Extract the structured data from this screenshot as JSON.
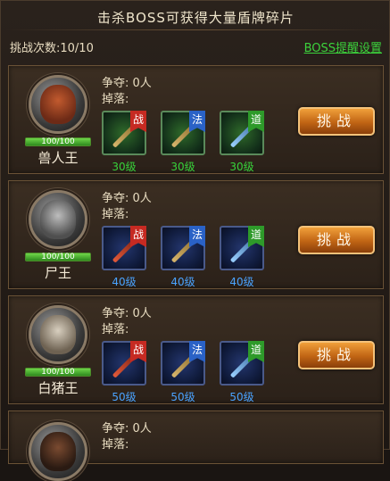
{
  "header": {
    "title": "击杀BOSS可获得大量盾牌碎片",
    "challenge_label": "挑战次数:10/10",
    "remind_link": "BOSS提醒设置"
  },
  "bosses": [
    {
      "name": "兽人王",
      "portrait_icon": "orc-king-portrait",
      "hp_text": "100/100",
      "contest": "争夺: 0人",
      "drop_label": "掉落:",
      "drops": [
        {
          "tag": "战",
          "level": "30级",
          "rarity": "green"
        },
        {
          "tag": "法",
          "level": "30级",
          "rarity": "green"
        },
        {
          "tag": "道",
          "level": "30级",
          "rarity": "green"
        }
      ],
      "button": "挑战"
    },
    {
      "name": "尸王",
      "portrait_icon": "corpse-king-portrait",
      "hp_text": "100/100",
      "contest": "争夺: 0人",
      "drop_label": "掉落:",
      "drops": [
        {
          "tag": "战",
          "level": "40级",
          "rarity": "blue"
        },
        {
          "tag": "法",
          "level": "40级",
          "rarity": "blue"
        },
        {
          "tag": "道",
          "level": "40级",
          "rarity": "blue"
        }
      ],
      "button": "挑战"
    },
    {
      "name": "白猪王",
      "portrait_icon": "white-boar-king-portrait",
      "hp_text": "100/100",
      "contest": "争夺: 0人",
      "drop_label": "掉落:",
      "drops": [
        {
          "tag": "战",
          "level": "50级",
          "rarity": "blue"
        },
        {
          "tag": "法",
          "level": "50级",
          "rarity": "blue"
        },
        {
          "tag": "道",
          "level": "50级",
          "rarity": "blue"
        }
      ],
      "button": "挑战"
    },
    {
      "name": "",
      "portrait_icon": "boss-portrait",
      "contest": "争夺: 0人",
      "drop_label": "掉落:"
    }
  ],
  "colors": {
    "green_level": "#37d23a",
    "blue_level": "#4aa3ff",
    "link": "#3cd23c"
  }
}
